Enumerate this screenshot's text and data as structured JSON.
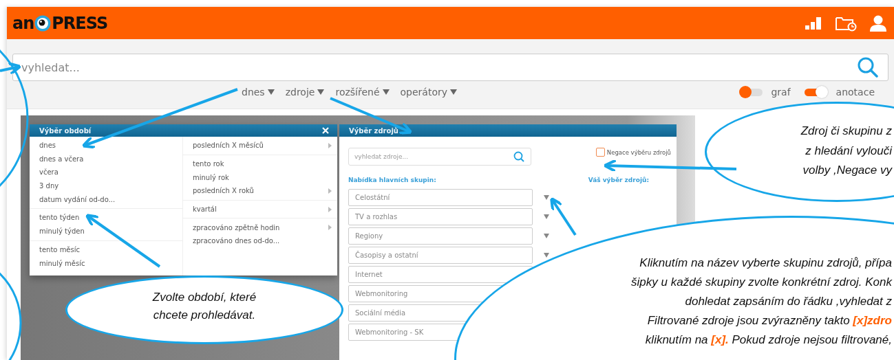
{
  "header": {
    "logo_left": "an",
    "logo_right": "PRESS"
  },
  "search": {
    "placeholder": "vyhledat..."
  },
  "filters": [
    {
      "label": "dnes"
    },
    {
      "label": "zdroje"
    },
    {
      "label": "rozšířené"
    },
    {
      "label": "operátory"
    }
  ],
  "toggles": [
    {
      "label": "graf",
      "on": false
    },
    {
      "label": "anotace",
      "on": true
    }
  ],
  "period_menu": {
    "title": "Výběr období",
    "left_groups": [
      {
        "items": [
          "dnes",
          "dnes a včera",
          "včera",
          "3 dny",
          "datum vydání od-do..."
        ]
      },
      {
        "items": [
          "tento týden",
          "minulý týden"
        ]
      },
      {
        "items": [
          "tento měsíc",
          "minulý měsíc"
        ]
      }
    ],
    "right_groups": [
      {
        "items": [
          {
            "label": "posledních X měsíců",
            "submenu": true
          }
        ]
      },
      {
        "items": [
          {
            "label": "tento rok",
            "submenu": false
          },
          {
            "label": "minulý rok",
            "submenu": false
          },
          {
            "label": "posledních X roků",
            "submenu": true
          }
        ]
      },
      {
        "items": [
          {
            "label": "kvartál",
            "submenu": true
          }
        ]
      },
      {
        "items": [
          {
            "label": "zpracováno zpětně hodin",
            "submenu": true
          },
          {
            "label": "zpracováno dnes od-do...",
            "submenu": false
          }
        ]
      }
    ]
  },
  "source_menu": {
    "title": "Výběr zdrojů",
    "search_placeholder": "vyhledat zdroje...",
    "negation": {
      "label": "Negace výběru zdrojů",
      "checked": false
    },
    "groups_heading": "Nabídka hlavních skupin:",
    "selection_heading": "Váš výběr zdrojů:",
    "groups": [
      {
        "label": "Celostátní"
      },
      {
        "label": "TV a rozhlas"
      },
      {
        "label": "Regiony"
      },
      {
        "label": "Časopisy a ostatní"
      },
      {
        "label": "Internet"
      },
      {
        "label": "Webmonitoring"
      },
      {
        "label": "Sociální média"
      },
      {
        "label": "Webmonitoring - SK"
      }
    ]
  },
  "callouts": [
    {
      "lines": [
        [
          {
            "text": "Zdroj či skupinu z",
            "kind": "plain"
          }
        ],
        [
          {
            "text": "z hledání vylouči",
            "kind": "plain"
          }
        ],
        [
          {
            "text": "volby ,Negace vy",
            "kind": "plain"
          }
        ]
      ]
    },
    {
      "lines": [
        [
          {
            "text": "Zvolte období, které",
            "kind": "plain"
          }
        ],
        [
          {
            "text": "chcete prohledávat.",
            "kind": "plain"
          }
        ]
      ]
    },
    {
      "lines": [
        [
          {
            "text": "Kliknutím na název vyberte skupinu zdrojů, přípa",
            "kind": "plain"
          }
        ],
        [
          {
            "text": "šipky u každé skupiny zvolte konkrétní zdroj. Konk",
            "kind": "plain"
          }
        ],
        [
          {
            "text": "dohledat zapsáním do řádku ,vyhledat z",
            "kind": "plain"
          }
        ],
        [
          {
            "text": "Filtrované zdroje jsou zvýrazněny takto ",
            "kind": "plain"
          },
          {
            "text": "[x]zdro",
            "kind": "highlight"
          }
        ],
        [
          {
            "text": "kliknutím na ",
            "kind": "plain"
          },
          {
            "text": "[x].",
            "kind": "highlight"
          },
          {
            "text": " Pokud zdroje nejsou filtrované,",
            "kind": "plain"
          }
        ]
      ]
    }
  ]
}
